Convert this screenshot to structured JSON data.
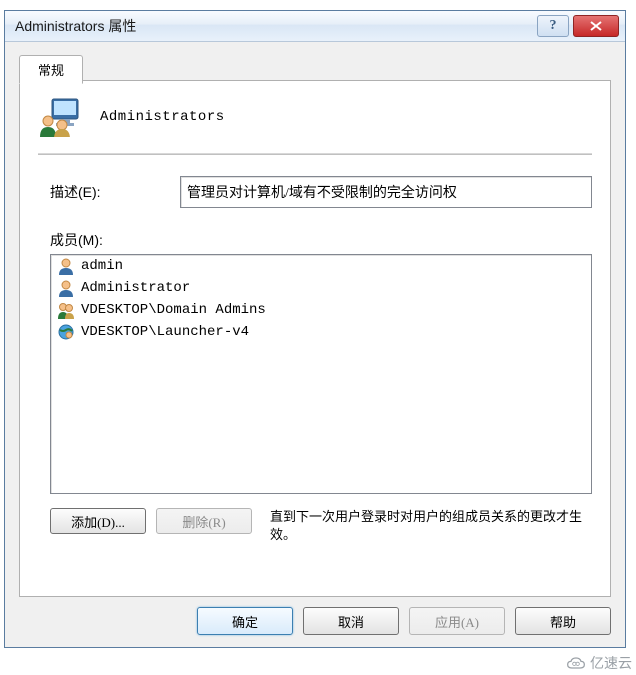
{
  "window": {
    "title": "Administrators 属性"
  },
  "tab": {
    "general": "常规"
  },
  "group": {
    "name": "Administrators"
  },
  "description": {
    "label": "描述(E):",
    "value": "管理员对计算机/域有不受限制的完全访问权"
  },
  "members": {
    "label": "成员(M):",
    "items": [
      {
        "icon": "user",
        "name": "admin"
      },
      {
        "icon": "user",
        "name": "Administrator"
      },
      {
        "icon": "group",
        "name": "VDESKTOP\\Domain Admins"
      },
      {
        "icon": "globe",
        "name": "VDESKTOP\\Launcher-v4"
      }
    ]
  },
  "buttons": {
    "add": "添加(D)...",
    "remove": "删除(R)",
    "note": "直到下一次用户登录时对用户的组成员关系的更改才生效。",
    "ok": "确定",
    "cancel": "取消",
    "apply": "应用(A)",
    "help": "帮助"
  },
  "watermark": "亿速云"
}
